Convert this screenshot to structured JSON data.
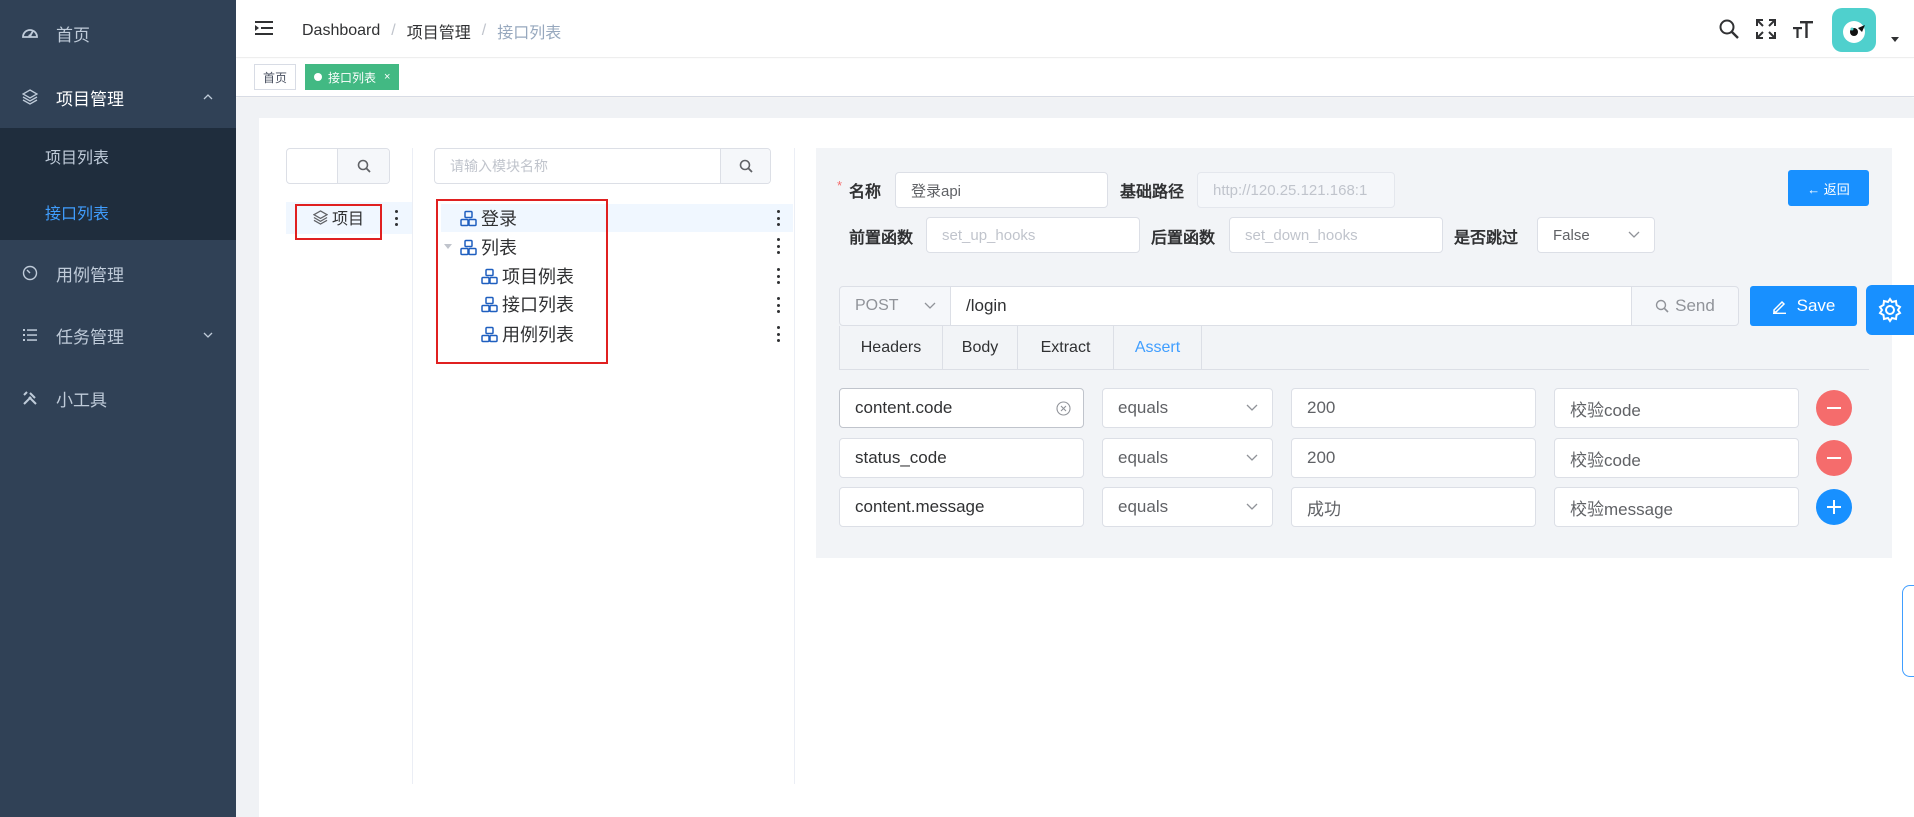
{
  "sidebar": {
    "items": [
      {
        "label": "首页",
        "icon": "dashboard-icon"
      },
      {
        "label": "项目管理",
        "icon": "layers-icon",
        "expanded": true,
        "children": [
          {
            "label": "项目列表"
          },
          {
            "label": "接口列表",
            "active": true
          }
        ]
      },
      {
        "label": "用例管理",
        "icon": "gauge-icon"
      },
      {
        "label": "任务管理",
        "icon": "list-icon"
      },
      {
        "label": "小工具",
        "icon": "tools-icon"
      }
    ]
  },
  "navbar": {
    "breadcrumb": [
      "Dashboard",
      "项目管理",
      "接口列表"
    ],
    "tools": [
      "search-icon",
      "fullscreen-icon",
      "font-size-icon"
    ]
  },
  "tags": [
    {
      "label": "首页"
    },
    {
      "label": "接口列表",
      "active": true,
      "close": "×"
    }
  ],
  "project_panel": {
    "search_value": "",
    "node_label": "项目"
  },
  "module_panel": {
    "search_placeholder": "请输入模块名称",
    "nodes": [
      {
        "label": "登录",
        "level": 0
      },
      {
        "label": "列表",
        "level": 0,
        "expanded": true
      },
      {
        "label": "项目例表",
        "level": 1
      },
      {
        "label": "接口列表",
        "level": 1
      },
      {
        "label": "用例列表",
        "level": 1
      }
    ]
  },
  "api_form": {
    "required_mark": "*",
    "name_label": "名称",
    "name_value": "登录api",
    "base_path_label": "基础路径",
    "base_path_placeholder": "http://120.25.121.168:1",
    "setup_label": "前置函数",
    "setup_placeholder": "set_up_hooks",
    "teardown_label": "后置函数",
    "teardown_placeholder": "set_down_hooks",
    "skip_label": "是否跳过",
    "skip_value": "False",
    "back_button": "← 返回",
    "method": "POST",
    "url": "/login",
    "send_label": "Send",
    "save_label": "Save",
    "tabs": [
      "Headers",
      "Body",
      "Extract",
      "Assert"
    ],
    "active_tab": "Assert",
    "asserts": [
      {
        "field": "content.code",
        "comparator": "equals",
        "expected": "200",
        "desc": "校验code",
        "action": "remove"
      },
      {
        "field": "status_code",
        "comparator": "equals",
        "expected": "200",
        "desc": "校验code",
        "action": "remove"
      },
      {
        "field": "content.message",
        "comparator": "equals",
        "expected": "成功",
        "desc": "校验message",
        "action": "add"
      }
    ]
  },
  "colors": {
    "sidebar_bg": "#304156",
    "submenu_bg": "#1f2d3d",
    "accent": "#409eff",
    "primary_button": "#1890ff",
    "tag_active": "#42b983",
    "danger": "#f56c6c",
    "highlight_box": "#e02020"
  }
}
